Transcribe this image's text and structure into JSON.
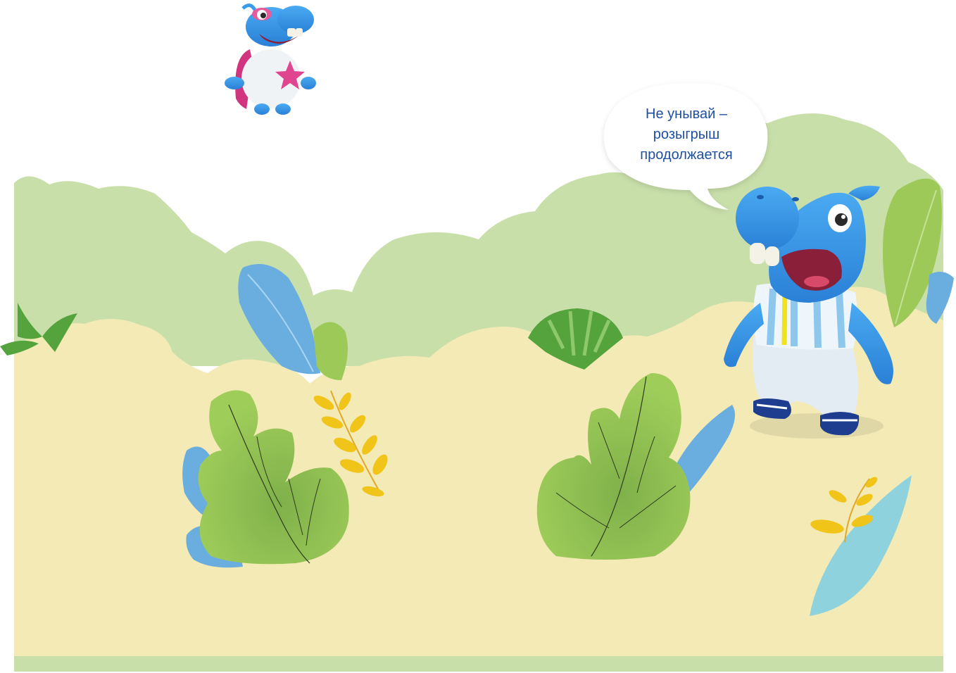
{
  "speech_bubble": {
    "lines": [
      "Не унывай –",
      "розыгрыш",
      "продолжается"
    ]
  },
  "characters": {
    "flying_hippo": {
      "description_icon": "hippo-hero-icon",
      "star_color": "#e0468f"
    },
    "standing_hippo": {
      "description_icon": "hippo-football-icon"
    }
  },
  "colors": {
    "back_bushes": "#c9dfaa",
    "ground": "#f3eab5",
    "ground_bottom_strip": "#c9dfaa",
    "leaf_green": "#9cc957",
    "leaf_blue": "#6aaee0",
    "leaf_yellow": "#f0c419",
    "hippo_blue": "#3a9bea",
    "bubble_text": "#1f4fa0"
  }
}
